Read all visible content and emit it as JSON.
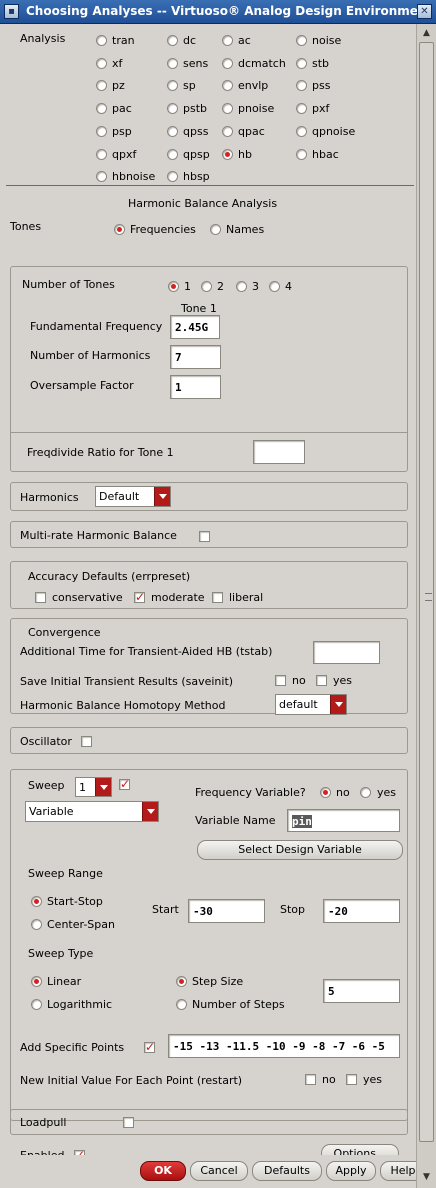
{
  "window": {
    "title": "Choosing Analyses -- Virtuoso® Analog Design Environmen"
  },
  "analysis": {
    "label": "Analysis",
    "types": [
      "tran",
      "dc",
      "ac",
      "noise",
      "xf",
      "sens",
      "dcmatch",
      "stb",
      "pz",
      "sp",
      "envlp",
      "pss",
      "pac",
      "pstb",
      "pnoise",
      "pxf",
      "psp",
      "qpss",
      "qpac",
      "qpnoise",
      "qpxf",
      "qpsp",
      "hb",
      "hbac",
      "hbnoise",
      "hbsp"
    ],
    "selected": "hb"
  },
  "hb": {
    "section_title": "Harmonic Balance Analysis",
    "tones_label": "Tones",
    "tones_options": [
      "Frequencies",
      "Names"
    ],
    "tones_selected": "Frequencies",
    "num_tones_label": "Number of Tones",
    "num_tones_options": [
      "1",
      "2",
      "3",
      "4"
    ],
    "num_tones_selected": "1",
    "tone_header": "Tone 1",
    "fund_freq_label": "Fundamental Frequency",
    "fund_freq_value": "2.45G",
    "num_harm_label": "Number of Harmonics",
    "num_harm_value": "7",
    "oversample_label": "Oversample Factor",
    "oversample_value": "1",
    "freqdivide_label": "Freqdivide Ratio for Tone 1",
    "freqdivide_value": "",
    "harmonics_label": "Harmonics",
    "harmonics_value": "Default",
    "multirate_label": "Multi-rate Harmonic Balance",
    "multirate_checked": false
  },
  "accuracy": {
    "title": "Accuracy Defaults (errpreset)",
    "options": [
      "conservative",
      "moderate",
      "liberal"
    ],
    "checked": "moderate"
  },
  "convergence": {
    "title": "Convergence",
    "tstab_label": "Additional Time for Transient-Aided HB (tstab)",
    "tstab_value": "",
    "saveinit_label": "Save Initial Transient Results (saveinit)",
    "saveinit_no": "no",
    "saveinit_yes": "yes",
    "homotopy_label": "Harmonic Balance Homotopy Method",
    "homotopy_value": "default"
  },
  "oscillator": {
    "label": "Oscillator",
    "checked": false
  },
  "sweep": {
    "label": "Sweep",
    "count": "1",
    "checked": true,
    "type_value": "Variable",
    "freq_var_label": "Frequency Variable?",
    "freq_var_no": "no",
    "freq_var_yes": "yes",
    "freq_var_selected": "no",
    "var_name_label": "Variable Name",
    "var_name_value": "pin",
    "select_var_button": "Select Design Variable",
    "range_title": "Sweep Range",
    "range_options": [
      "Start-Stop",
      "Center-Span"
    ],
    "range_selected": "Start-Stop",
    "start_label": "Start",
    "start_value": "-30",
    "stop_label": "Stop",
    "stop_value": "-20",
    "type_title": "Sweep Type",
    "type_options": [
      "Linear",
      "Logarithmic"
    ],
    "type_selected": "Linear",
    "step_options": [
      "Step Size",
      "Number of Steps"
    ],
    "step_selected": "Step Size",
    "step_value": "5",
    "specific_label": "Add Specific Points",
    "specific_checked": true,
    "specific_value": "-15 -13 -11.5 -10 -9 -8 -7 -6 -5",
    "restart_label": "New Initial Value For Each Point (restart)",
    "restart_no": "no",
    "restart_yes": "yes"
  },
  "loadpull": {
    "label": "Loadpull",
    "checked": false
  },
  "enabled": {
    "label": "Enabled",
    "checked": true,
    "options_button": "Options..."
  },
  "footer": {
    "ok": "OK",
    "cancel": "Cancel",
    "defaults": "Defaults",
    "apply": "Apply",
    "help": "Help"
  }
}
